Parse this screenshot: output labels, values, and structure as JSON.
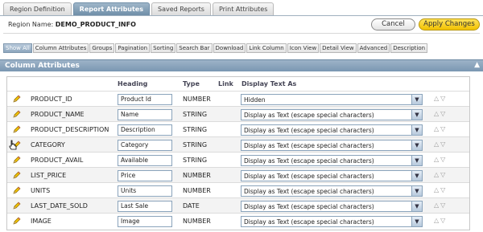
{
  "tabs": [
    {
      "label": "Region Definition",
      "active": false
    },
    {
      "label": "Report Attributes",
      "active": true
    },
    {
      "label": "Saved Reports",
      "active": false
    },
    {
      "label": "Print Attributes",
      "active": false
    }
  ],
  "region": {
    "label": "Region Name:",
    "name": "DEMO_PRODUCT_INFO",
    "cancel_label": "Cancel",
    "apply_label": "Apply Changes"
  },
  "subtabs": [
    {
      "label": "Show All",
      "active": true
    },
    {
      "label": "Column Attributes",
      "active": false
    },
    {
      "label": "Groups",
      "active": false
    },
    {
      "label": "Pagination",
      "active": false
    },
    {
      "label": "Sorting",
      "active": false
    },
    {
      "label": "Search Bar",
      "active": false
    },
    {
      "label": "Download",
      "active": false
    },
    {
      "label": "Link Column",
      "active": false
    },
    {
      "label": "Icon View",
      "active": false
    },
    {
      "label": "Detail View",
      "active": false
    },
    {
      "label": "Advanced",
      "active": false
    },
    {
      "label": "Description",
      "active": false
    }
  ],
  "section": {
    "title": "Column Attributes"
  },
  "table": {
    "headers": {
      "heading": "Heading",
      "type": "Type",
      "link": "Link",
      "display": "Display Text As"
    },
    "rows": [
      {
        "column": "PRODUCT_ID",
        "heading": "Product Id",
        "type": "NUMBER",
        "display": "Hidden"
      },
      {
        "column": "PRODUCT_NAME",
        "heading": "Name",
        "type": "STRING",
        "display": "Display as Text (escape special characters)"
      },
      {
        "column": "PRODUCT_DESCRIPTION",
        "heading": "Description",
        "type": "STRING",
        "display": "Display as Text (escape special characters)"
      },
      {
        "column": "CATEGORY",
        "heading": "Category",
        "type": "STRING",
        "display": "Display as Text (escape special characters)"
      },
      {
        "column": "PRODUCT_AVAIL",
        "heading": "Available",
        "type": "STRING",
        "display": "Display as Text (escape special characters)"
      },
      {
        "column": "LIST_PRICE",
        "heading": "Price",
        "type": "NUMBER",
        "display": "Display as Text (escape special characters)"
      },
      {
        "column": "UNITS",
        "heading": "Units",
        "type": "NUMBER",
        "display": "Display as Text (escape special characters)"
      },
      {
        "column": "LAST_DATE_SOLD",
        "heading": "Last Sale",
        "type": "DATE",
        "display": "Display as Text (escape special characters)"
      },
      {
        "column": "IMAGE",
        "heading": "Image",
        "type": "NUMBER",
        "display": "Display as Text (escape special characters)"
      }
    ]
  },
  "icons": {
    "edit": "pencil-icon",
    "move": "up-down-arrows-icon",
    "collapse": "up-arrow-icon",
    "dropdown": "chevron-down-icon"
  }
}
